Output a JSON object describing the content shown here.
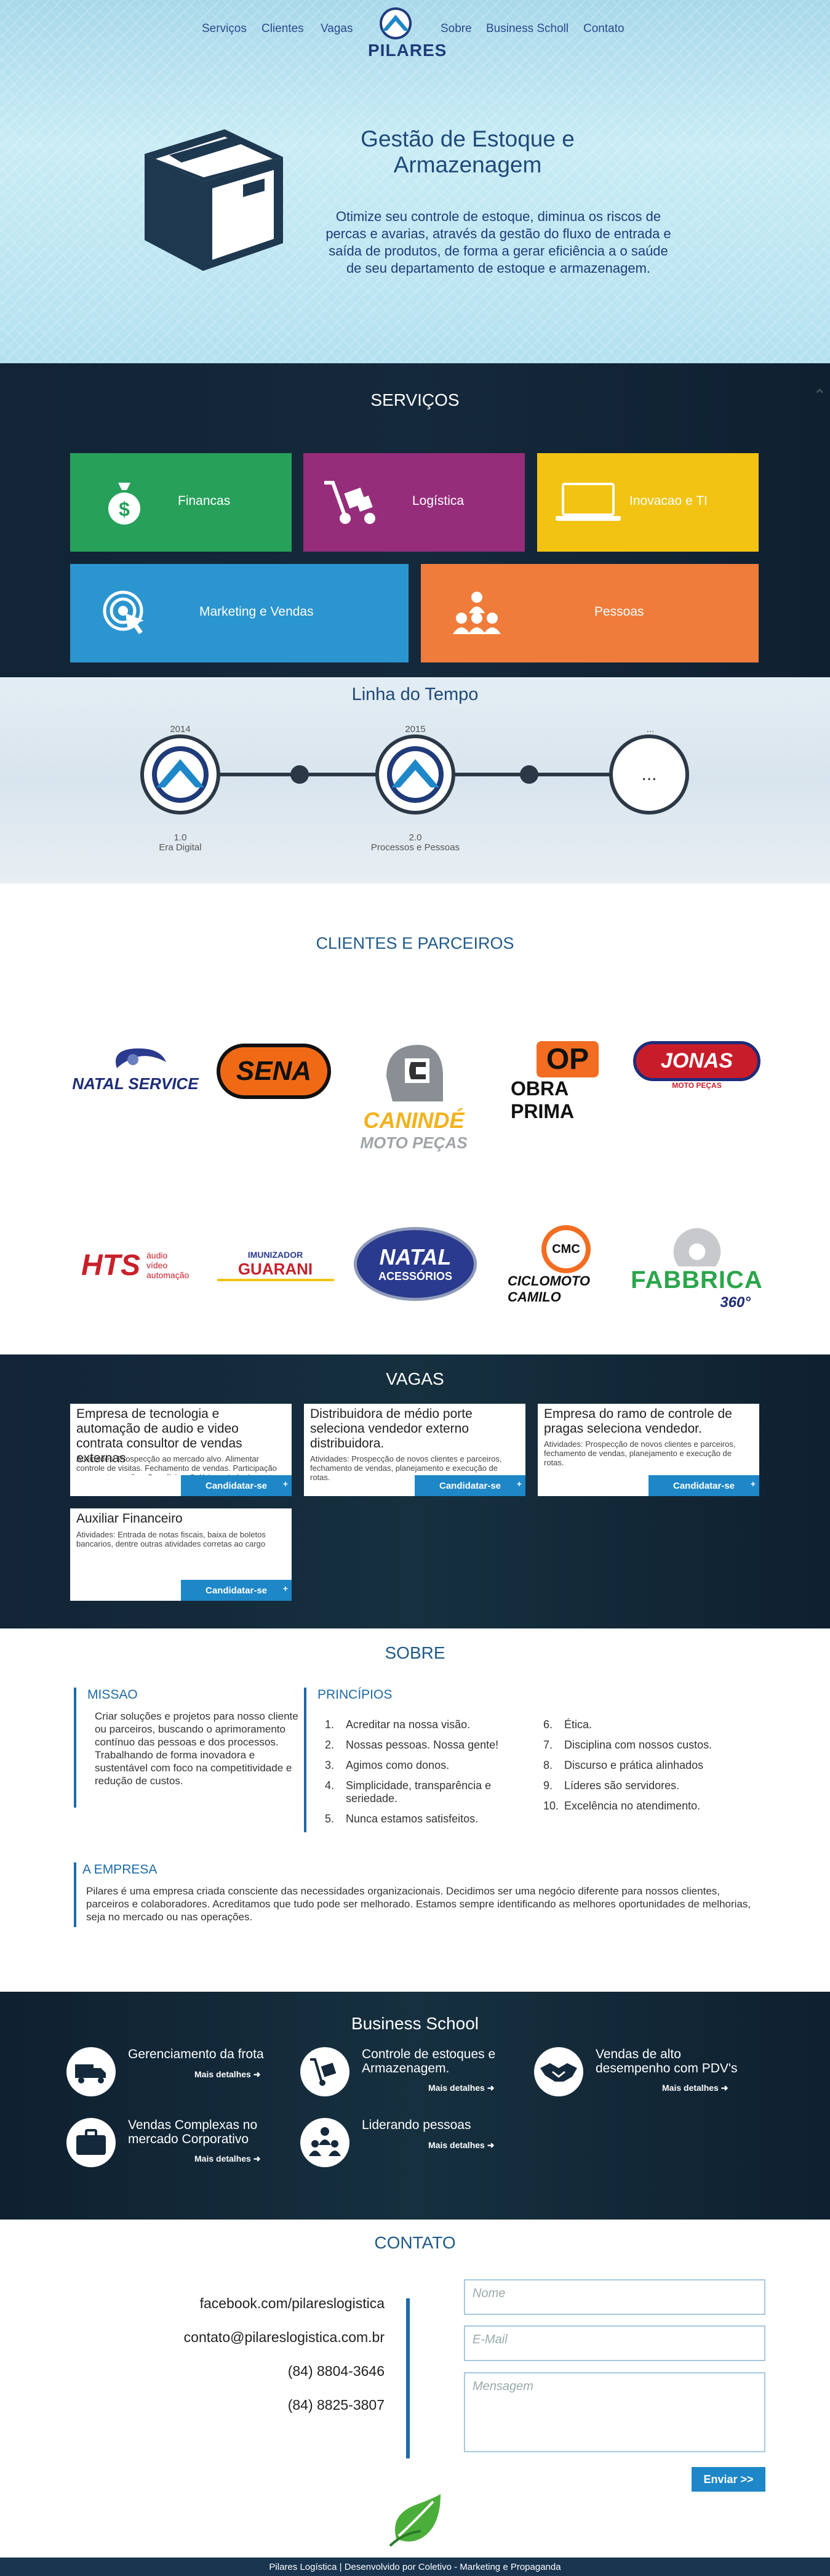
{
  "nav": {
    "items": [
      "Serviços",
      "Clientes",
      "Vagas",
      "Sobre",
      "Business Scholl",
      "Contato"
    ],
    "logo_text": "PILARES"
  },
  "hero": {
    "title": "Gestão de Estoque e Armazenagem",
    "text": "Otimize seu controle de estoque, diminua os riscos de percas e avarias, através da gestão do fluxo de entrada e saída de produtos, de forma a gerar eficiência a o saúde de seu departamento de estoque e armazenagem."
  },
  "services": {
    "title": "SERVIÇOS",
    "tiles": [
      {
        "label": "Financas",
        "color": "#27a05a",
        "icon": "money-bag-icon"
      },
      {
        "label": "Logística",
        "color": "#962d7b",
        "icon": "hand-truck-icon"
      },
      {
        "label": "Inovacao e TI",
        "color": "#f2c313",
        "icon": "laptop-icon"
      },
      {
        "label": "Marketing e Vendas",
        "color": "#2b95cf",
        "icon": "target-click-icon"
      },
      {
        "label": "Pessoas",
        "color": "#ef7c3a",
        "icon": "people-icon"
      }
    ]
  },
  "timeline": {
    "title": "Linha do Tempo",
    "nodes": [
      {
        "year": "2014",
        "version": "1.0",
        "label": "Era Digital"
      },
      {
        "year": "2015",
        "version": "2.0",
        "label": "Processos e Pessoas"
      },
      {
        "year": "...",
        "version": "",
        "label": ""
      }
    ],
    "more": "..."
  },
  "clients": {
    "title": "CLIENTES E PARCEIROS",
    "logos": [
      {
        "name": "NATAL SERVICE"
      },
      {
        "name": "SENA"
      },
      {
        "name": "CANINDÉ",
        "sub": "MOTO PEÇAS"
      },
      {
        "name": "OBRA PRIMA",
        "badge": "OP"
      },
      {
        "name": "JONAS",
        "sub": "MOTO PEÇAS"
      },
      {
        "name": "HTS",
        "sub": "áudio vídeo automação"
      },
      {
        "name": "GUARANI",
        "sub": "IMUNIZADOR"
      },
      {
        "name": "NATAL",
        "sub": "ACESSÓRIOS"
      },
      {
        "name": "CICLOMOTO CAMILO",
        "badge": "CMC"
      },
      {
        "name": "FABBRICA",
        "sub": "360°"
      }
    ]
  },
  "vagas": {
    "title": "VAGAS",
    "button_label": "Candidatar-se",
    "button_plus": "+",
    "jobs": [
      {
        "title": "Empresa de tecnologia e automação de audio e video contrata consultor de vendas externas",
        "desc": "Atividades: Prospecção ao mercado alvo. Alimentar controle de visitas. Fechamento de vendas. Participação em eventos e afins. Benefícios: Salário + ajuda de custo. + Alimentação"
      },
      {
        "title": "Distribuidora de médio porte seleciona vendedor externo distribuidora.",
        "desc": "Atividades: Prospecção de novos clientes e parceiros, fechamento de vendas, planejamento e execução de rotas."
      },
      {
        "title": "Empresa do ramo de controle de pragas seleciona vendedor.",
        "desc": "Atividades: Prospecção de novos clientes e parceiros, fechamento de vendas, planejamento e execução de rotas."
      },
      {
        "title": "Auxiliar Financeiro",
        "desc": "Atividades: Entrada de notas fiscais, baixa de boletos bancarios, dentre outras atividades corretas ao cargo"
      }
    ]
  },
  "sobre": {
    "title": "SOBRE",
    "missao_head": "MISSAO",
    "missao_text": "Criar soluções e projetos para nosso cliente ou parceiros, buscando o aprimoramento contínuo das pessoas e dos processos. Trabalhando de forma inovadora e sustentável com foco na competitividade e redução de custos.",
    "principios_head": "PRINCÍPIOS",
    "principios": [
      {
        "n": "1.",
        "t": "Acreditar na nossa visão."
      },
      {
        "n": "2.",
        "t": "Nossas pessoas. Nossa gente!"
      },
      {
        "n": "3.",
        "t": "Agimos como donos."
      },
      {
        "n": "4.",
        "t": "Simplicidade, transparência e seriedade."
      },
      {
        "n": "5.",
        "t": "Nunca estamos satisfeitos."
      },
      {
        "n": "6.",
        "t": "Ética."
      },
      {
        "n": "7.",
        "t": "Disciplina com nossos custos."
      },
      {
        "n": "8.",
        "t": "Discurso e prática alinhados"
      },
      {
        "n": "9.",
        "t": "Líderes são servidores."
      },
      {
        "n": "10.",
        "t": "Excelência no atendimento."
      }
    ],
    "empresa_head": "A EMPRESA",
    "empresa_text": "Pilares é uma empresa criada consciente das necessidades organizacionais. Decidimos ser uma negócio diferente para nossos clientes, parceiros e colaboradores. Acreditamos que tudo pode ser melhorado. Estamos sempre identificando as melhores oportunidades de melhorias, seja no mercado ou nas operações."
  },
  "business": {
    "title": "Business School",
    "more_label": "Mais detalhes",
    "items": [
      {
        "title": "Gerenciamento da frota",
        "icon": "truck-icon"
      },
      {
        "title": "Controle de estoques e Armazenagem.",
        "icon": "hand-truck-icon"
      },
      {
        "title": "Vendas de alto desempenho com PDV's",
        "icon": "handshake-icon"
      },
      {
        "title": "Vendas Complexas no mercado Corporativo",
        "icon": "briefcase-icon"
      },
      {
        "title": "Liderando pessoas",
        "icon": "people-icon"
      }
    ]
  },
  "contato": {
    "title": "CONTATO",
    "facebook": "facebook.com/pilareslogistica",
    "email": "contato@pilareslogistica.com.br",
    "phone1": "(84) 8804-3646",
    "phone2": "(84) 8825-3807",
    "name_placeholder": "Nome",
    "email_placeholder": "E-Mail",
    "message_placeholder": "Mensagem",
    "send_label": "Enviar >>"
  },
  "footer": {
    "text": "Pilares Logística | Desenvolvido por Coletivo - Marketing e Propaganda"
  }
}
